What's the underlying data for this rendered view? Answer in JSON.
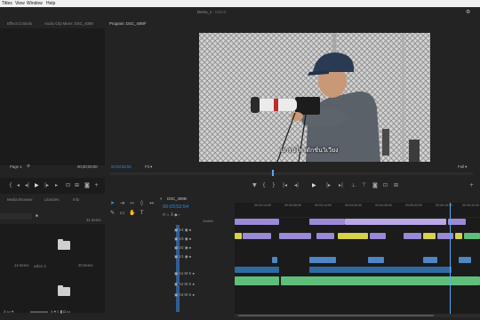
{
  "menubar": {
    "items": [
      "Titles",
      "View",
      "Window",
      "Help"
    ]
  },
  "window": {
    "title": "Demo_1",
    "title_suffix": " - Edited"
  },
  "source_panel": {
    "tabs": [
      "Effect Controls",
      "Audio Clip Mixer: DSC_4089"
    ],
    "page_label": "Page 1",
    "timecode": "00;00;00;00"
  },
  "program_monitor": {
    "tab_label": "Program: DSC_4089",
    "timecode": "00:03:52:54",
    "fit_label": "Fit",
    "quality_label": "Full",
    "subtitle": "แกรบโพรดักชั่นวิเวียง"
  },
  "project_panel": {
    "tabs": [
      "Media Browser",
      "Libraries",
      "Info"
    ],
    "item_count": "31 Items",
    "folders": [
      {
        "label": "14 Items"
      },
      {
        "label": "หลังก 2"
      },
      {
        "label": "20 Items"
      }
    ]
  },
  "timeline": {
    "tab_label": "DSC_4089",
    "timecode": "00:03:52:54",
    "ruler_labels": [
      "00:03:14:00",
      "00:03:58:00",
      "00:04:14:00",
      "00:04:30:00",
      "00:04:46:00",
      "00:05:02:00",
      "00:05:18:00",
      "00:05:30:00"
    ],
    "subtracks_label": "Subtitle",
    "video_tracks": [
      "V4",
      "V3",
      "V2",
      "V1"
    ],
    "audio_tracks": [
      "A1",
      "A2",
      "A3"
    ]
  },
  "colors": {
    "accent": "#2d8ceb",
    "video_clip": "#9a89d6",
    "title_clip": "#d8d24a",
    "audio_clip": "#5fbf7a",
    "playhead": "#5aa9f0"
  }
}
